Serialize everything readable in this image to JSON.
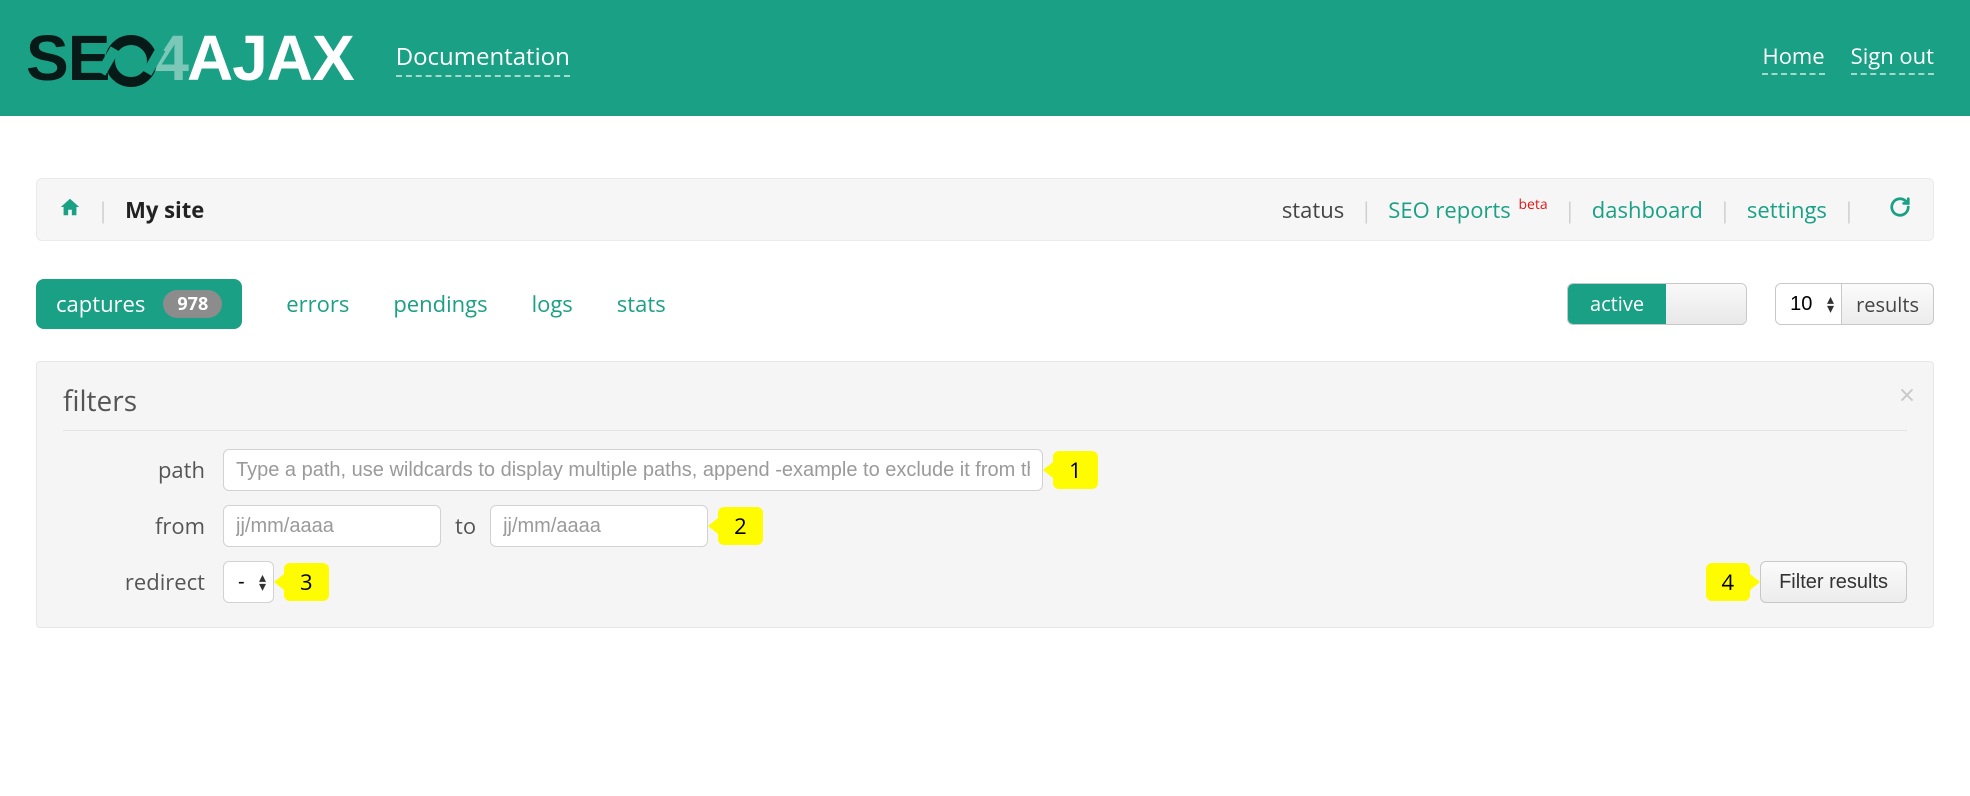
{
  "header": {
    "logo_seo": "SE",
    "logo_num": "4",
    "logo_ajax": "AJAX",
    "documentation": "Documentation",
    "home": "Home",
    "signout": "Sign out"
  },
  "sitebar": {
    "site_name": "My site",
    "links": {
      "status": "status",
      "seo_reports": "SEO reports",
      "beta": "beta",
      "dashboard": "dashboard",
      "settings": "settings"
    }
  },
  "tabs": {
    "captures": "captures",
    "captures_count": "978",
    "errors": "errors",
    "pendings": "pendings",
    "logs": "logs",
    "stats": "stats",
    "toggle_active": "active",
    "results_value": "10",
    "results_label": "results"
  },
  "filters": {
    "title": "filters",
    "labels": {
      "path": "path",
      "from": "from",
      "to": "to",
      "redirect": "redirect"
    },
    "path_placeholder": "Type a path, use wildcards to display multiple paths, append -example to exclude it from the result",
    "date_placeholder": "jj/mm/aaaa",
    "redirect_value": "-",
    "filter_button": "Filter results"
  },
  "callouts": {
    "c1": "1",
    "c2": "2",
    "c3": "3",
    "c4": "4"
  }
}
